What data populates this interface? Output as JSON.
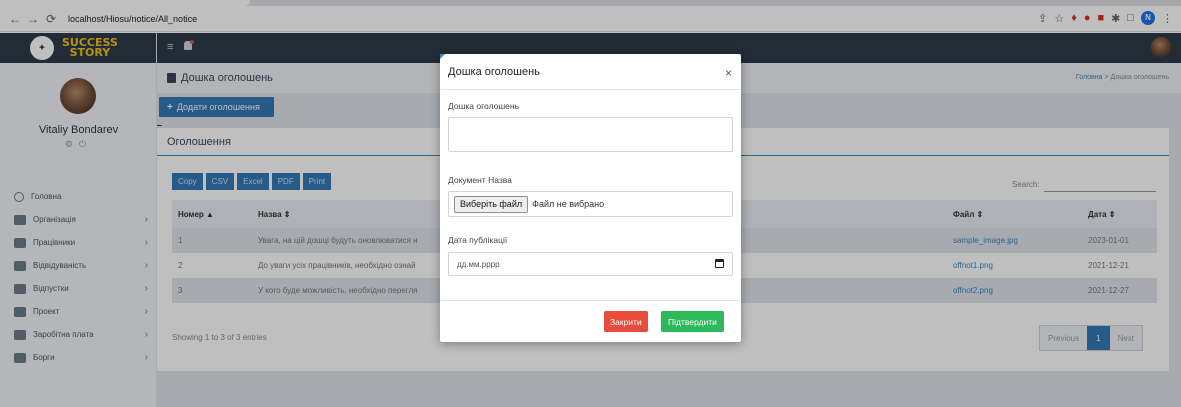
{
  "browser": {
    "url": "localhost/Hiosu/notice/All_notice"
  },
  "sidebar": {
    "logo_line1": "SUCCESS",
    "logo_line2": "STORY",
    "user_name": "Vitaliy Bondarev",
    "items": [
      {
        "label": "Головна",
        "icon": "dashboard-icon"
      },
      {
        "label": "Організація",
        "icon": "organization-icon"
      },
      {
        "label": "Працівники",
        "icon": "employees-icon"
      },
      {
        "label": "Відвідуваність",
        "icon": "attendance-icon"
      },
      {
        "label": "Відпустки",
        "icon": "vacation-icon"
      },
      {
        "label": "Проект",
        "icon": "project-icon"
      },
      {
        "label": "Заробітна плата",
        "icon": "salary-icon"
      },
      {
        "label": "Борги",
        "icon": "debts-icon"
      }
    ]
  },
  "page": {
    "title": "Дошка оголошень",
    "breadcrumb_home": "Головна",
    "breadcrumb_sep": ">",
    "breadcrumb_current": "Дошка оголошень",
    "add_button": "Додати оголошення",
    "card_title": "Оголошення"
  },
  "table": {
    "export_buttons": [
      "Copy",
      "CSV",
      "Excel",
      "PDF",
      "Print"
    ],
    "search_label": "Search:",
    "columns": [
      "Номер",
      "Назва",
      "Файл",
      "Дата"
    ],
    "rows": [
      {
        "num": "1",
        "title": "Увага, на цій дошці будуть оновлюватися н",
        "file": "sample_image.jpg",
        "date": "2023-01-01"
      },
      {
        "num": "2",
        "title": "До уваги усіх працівників, необхідно ознай",
        "file": "offnot1.png",
        "date": "2021-12-21"
      },
      {
        "num": "3",
        "title": "У кого буде можливість, необхідно перегля",
        "file": "offnot2.png",
        "date": "2021-12-27"
      }
    ],
    "info": "Showing 1 to 3 of 3 entries",
    "pager": {
      "prev": "Previous",
      "current": "1",
      "next": "Next"
    }
  },
  "modal": {
    "title": "Дошка оголошень",
    "field1_label": "Дошка оголошень",
    "field2_label": "Документ Назва",
    "file_button": "Виберіть файл",
    "file_status": "Файл не вибрано",
    "field3_label": "Дата публікації",
    "date_placeholder": "дд.мм.рррр",
    "close_button": "Закрити",
    "confirm_button": "Підтвердити"
  },
  "colors": {
    "navbar": "#2c3b48",
    "primary": "#337ab7",
    "danger": "#e74c3c",
    "success": "#2eb85c",
    "logo_text": "#f5c518"
  }
}
